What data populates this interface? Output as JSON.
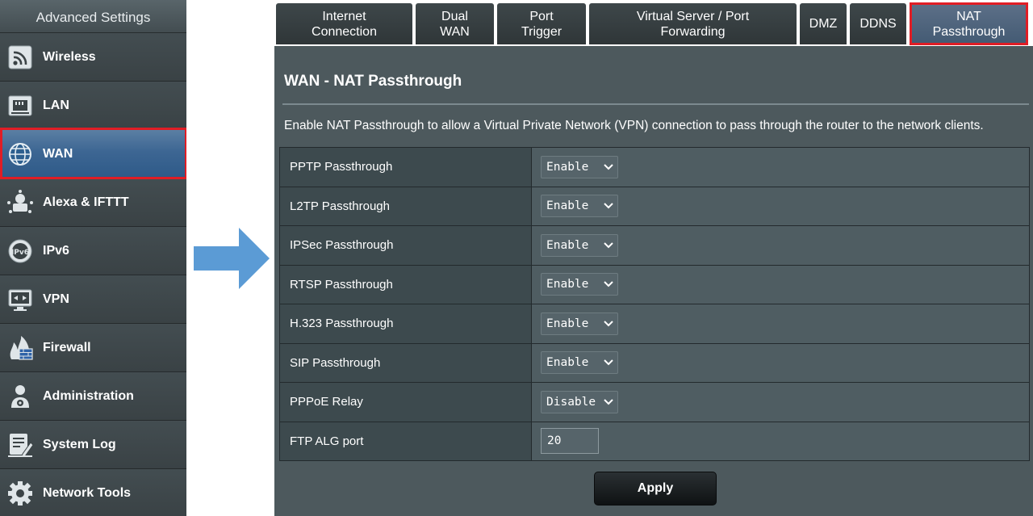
{
  "sidebar": {
    "header": "Advanced Settings",
    "items": [
      {
        "label": "Wireless",
        "icon": "wireless-icon"
      },
      {
        "label": "LAN",
        "icon": "lan-icon"
      },
      {
        "label": "WAN",
        "icon": "globe-icon",
        "active": true
      },
      {
        "label": "Alexa & IFTTT",
        "icon": "alexa-icon"
      },
      {
        "label": "IPv6",
        "icon": "ipv6-icon"
      },
      {
        "label": "VPN",
        "icon": "vpn-icon"
      },
      {
        "label": "Firewall",
        "icon": "firewall-icon"
      },
      {
        "label": "Administration",
        "icon": "administration-icon"
      },
      {
        "label": "System Log",
        "icon": "system-log-icon"
      },
      {
        "label": "Network Tools",
        "icon": "network-tools-icon"
      }
    ]
  },
  "tabs": [
    {
      "label": "Internet\nConnection"
    },
    {
      "label": "Dual\nWAN"
    },
    {
      "label": "Port\nTrigger"
    },
    {
      "label": "Virtual Server / Port\nForwarding"
    },
    {
      "label": "DMZ"
    },
    {
      "label": "DDNS"
    },
    {
      "label": "NAT\nPassthrough",
      "active": true
    }
  ],
  "page": {
    "title": "WAN - NAT Passthrough",
    "description": "Enable NAT Passthrough to allow a Virtual Private Network (VPN) connection to pass through the router to the network clients."
  },
  "settings": [
    {
      "label": "PPTP Passthrough",
      "value": "Enable"
    },
    {
      "label": "L2TP Passthrough",
      "value": "Enable"
    },
    {
      "label": "IPSec Passthrough",
      "value": "Enable"
    },
    {
      "label": "RTSP Passthrough",
      "value": "Enable"
    },
    {
      "label": "H.323 Passthrough",
      "value": "Enable"
    },
    {
      "label": "SIP Passthrough",
      "value": "Enable"
    },
    {
      "label": "PPPoE Relay",
      "value": "Disable"
    }
  ],
  "ftp_alg": {
    "label": "FTP ALG port",
    "value": "20"
  },
  "apply_label": "Apply",
  "colors": {
    "highlight": "#e01d25",
    "arrow": "#5b9bd5",
    "active_nav": "#3d6693",
    "panel": "#4d595d"
  }
}
